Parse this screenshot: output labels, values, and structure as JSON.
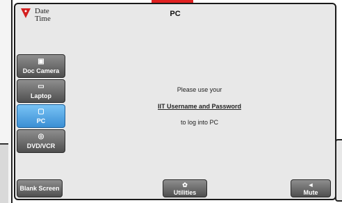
{
  "header": {
    "datetime_line1": "Date",
    "datetime_line2": "Time",
    "title": "PC"
  },
  "sources": [
    {
      "label": "Doc Camera",
      "icon": "image-icon",
      "active": false
    },
    {
      "label": "Laptop",
      "icon": "laptop-icon",
      "active": false
    },
    {
      "label": "PC",
      "icon": "monitor-icon",
      "active": true
    },
    {
      "label": "DVD/VCR",
      "icon": "dvd-icon",
      "active": false
    }
  ],
  "message": {
    "line1": "Please use your",
    "line2": "IIT Username and Password",
    "line3": "to log into PC"
  },
  "bottom": {
    "blank_screen": "Blank Screen",
    "utilities": "Utilities",
    "mute": "Mute"
  },
  "colors": {
    "active": "#3b8fd4",
    "accent": "#e02020"
  }
}
